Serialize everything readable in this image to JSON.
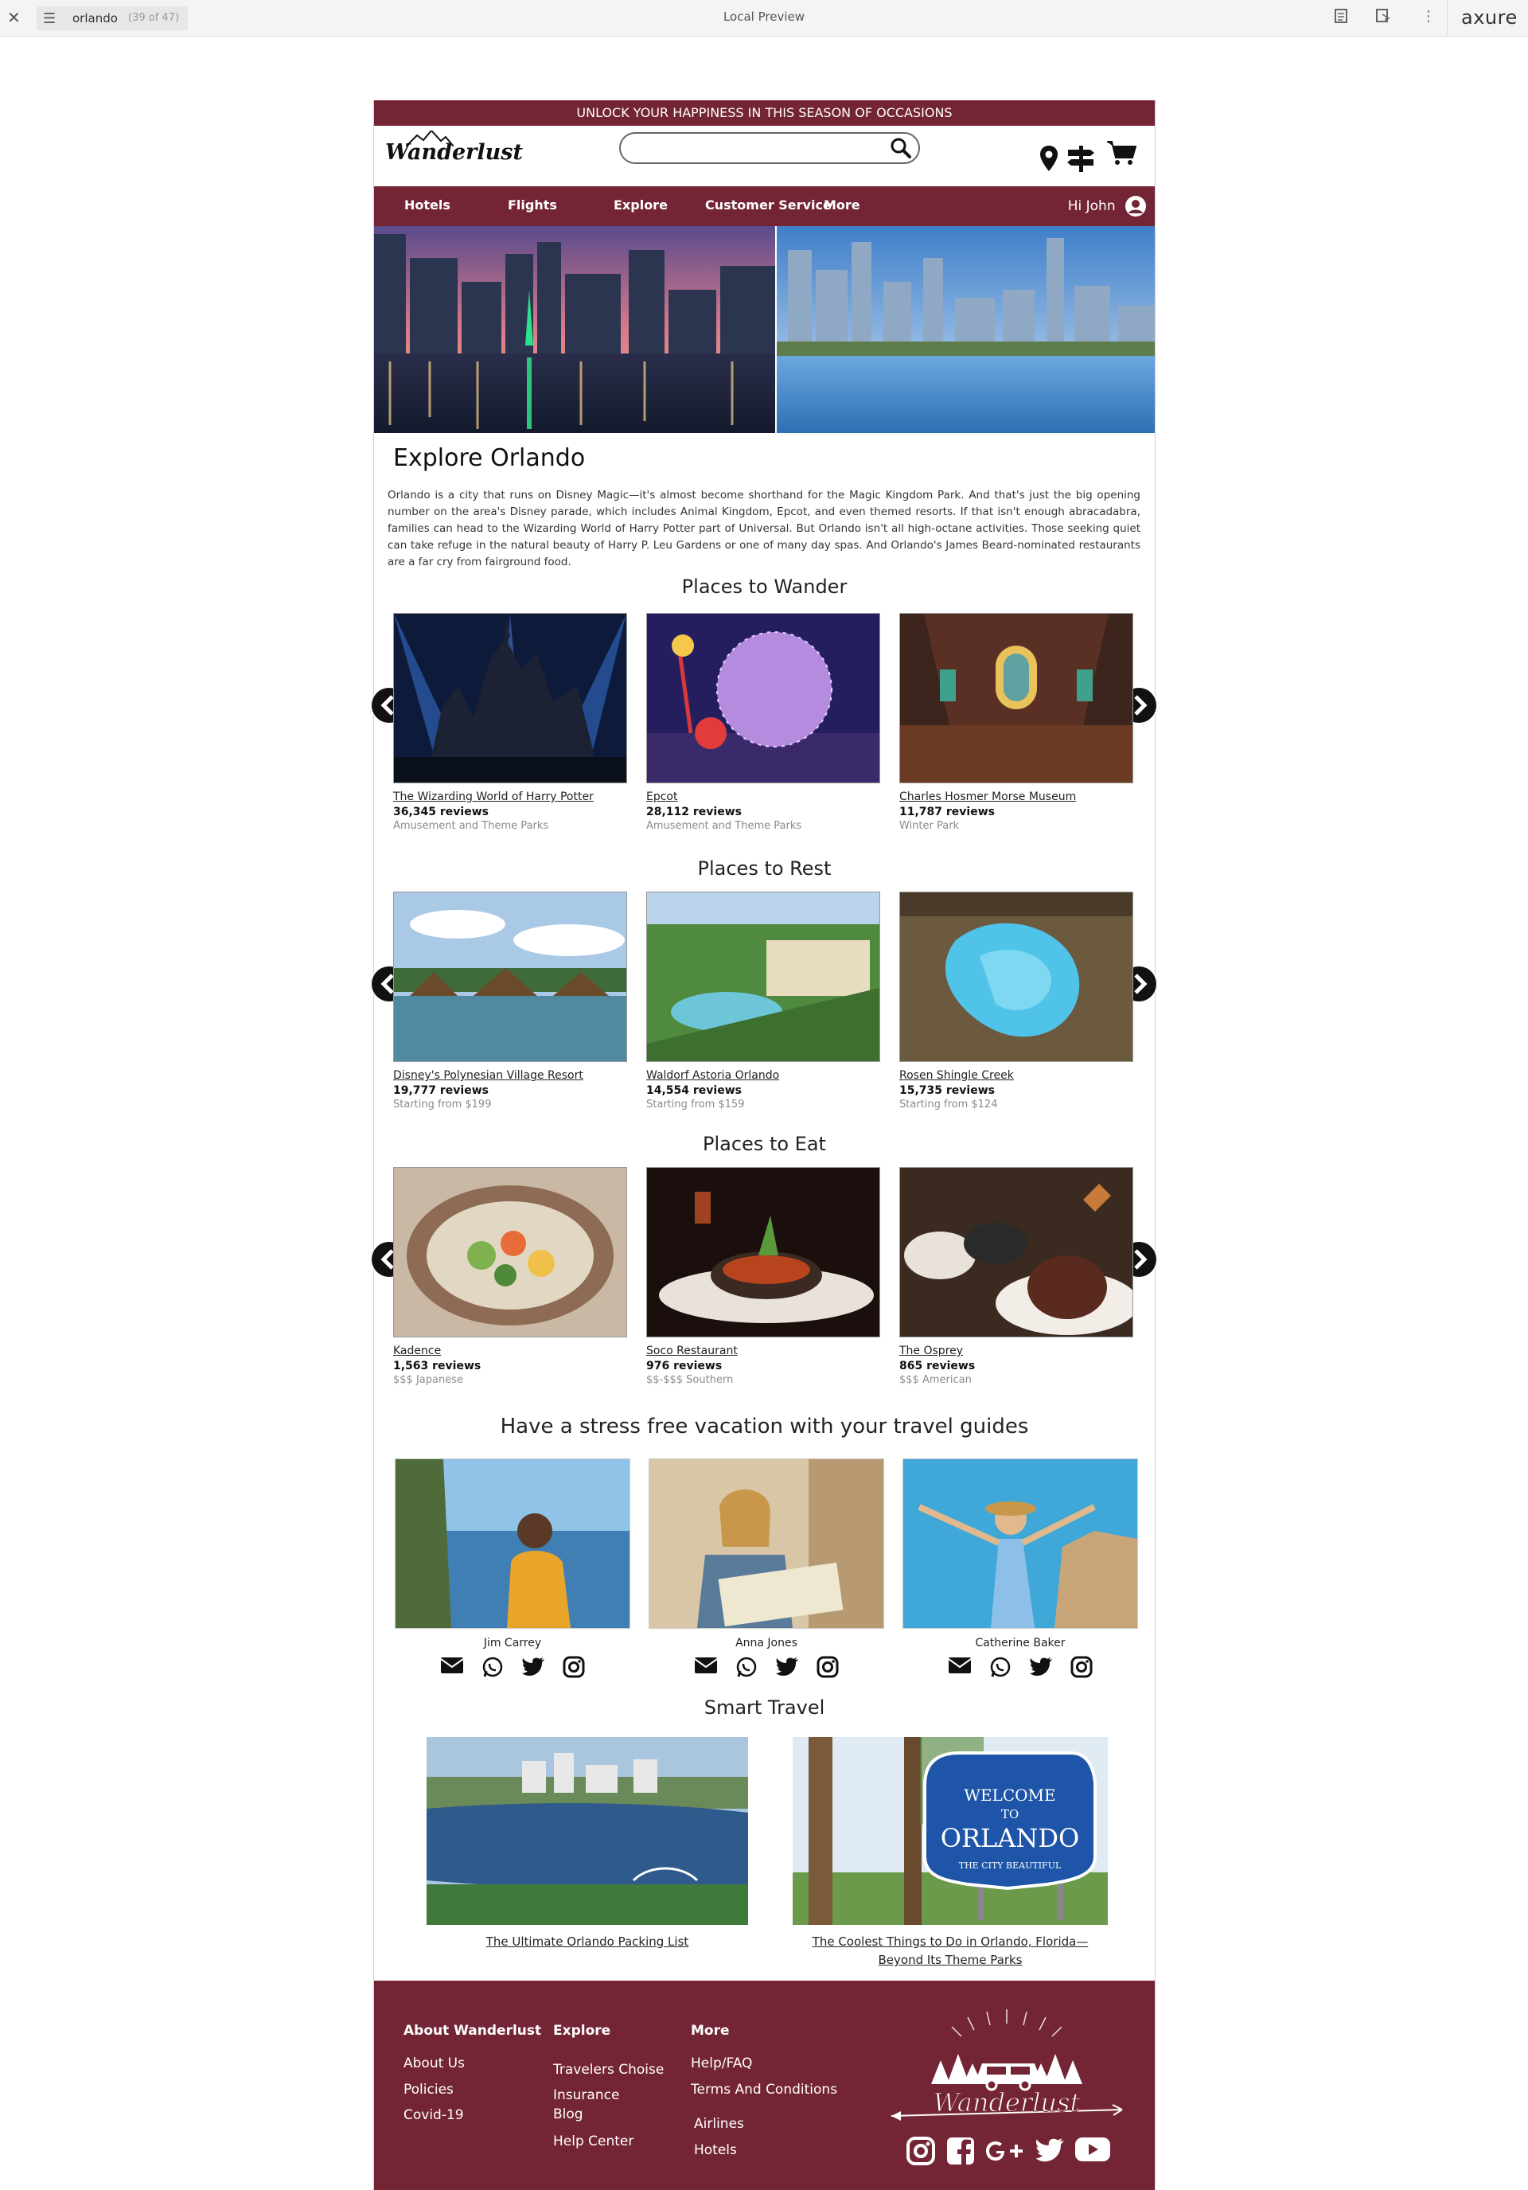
{
  "viewer": {
    "page_name": "orlando",
    "page_count": "(39 of 47)",
    "title": "Local Preview",
    "brand": "axure"
  },
  "promo": {
    "text": "UNLOCK YOUR HAPPINESS IN THIS SEASON OF OCCASIONS"
  },
  "header": {
    "logo_text": "Wanderlust",
    "search_placeholder": "",
    "icons": [
      "location-pin-icon",
      "signpost-icon",
      "cart-icon"
    ]
  },
  "nav": {
    "items": [
      "Hotels",
      "Flights",
      "Explore",
      "Customer Service",
      "More"
    ],
    "user_greeting": "Hi John"
  },
  "explore": {
    "title": "Explore Orlando",
    "text": "Orlando is a city that runs on Disney Magic—it's almost become shorthand for the Magic Kingdom Park. And that's just the big opening number on the area's Disney parade, which includes Animal Kingdom, Epcot, and even themed resorts. If that isn't enough abracadabra, families can head to the Wizarding World of Harry Potter part of Universal. But Orlando isn't all high-octane activities. Those seeking quiet can take refuge in the natural beauty of Harry P. Leu Gardens or one of many day spas. And Orlando's James Beard-nominated restaurants are a far cry from fairground food."
  },
  "wander": {
    "title": "Places to Wander",
    "items": [
      {
        "name": "The Wizarding World of Harry Potter",
        "reviews": "36,345 reviews",
        "sub": "Amusement and Theme Parks"
      },
      {
        "name": "Epcot",
        "reviews": "28,112 reviews",
        "sub": "Amusement and Theme Parks"
      },
      {
        "name": "Charles Hosmer Morse Museum",
        "reviews": "11,787 reviews",
        "sub": "Winter Park"
      }
    ]
  },
  "rest": {
    "title": "Places to Rest",
    "items": [
      {
        "name": "Disney's Polynesian Village Resort",
        "reviews": "19,777 reviews",
        "sub": "Starting from $199"
      },
      {
        "name": "Waldorf Astoria Orlando",
        "reviews": "14,554 reviews",
        "sub": "Starting from $159"
      },
      {
        "name": "Rosen Shingle Creek",
        "reviews": "15,735 reviews",
        "sub": "Starting from $124"
      }
    ]
  },
  "eat": {
    "title": "Places to Eat",
    "items": [
      {
        "name": "Kadence",
        "reviews": "1,563 reviews",
        "sub": "$$$ Japanese"
      },
      {
        "name": "Soco Restaurant",
        "reviews": "976 reviews",
        "sub": "$$-$$$ Southern"
      },
      {
        "name": "The Osprey",
        "reviews": "865 reviews",
        "sub": "$$$ American"
      }
    ]
  },
  "guides": {
    "title": "Have a stress free vacation with your travel guides",
    "items": [
      {
        "name": "Jim Carrey"
      },
      {
        "name": "Anna Jones"
      },
      {
        "name": "Catherine Baker"
      }
    ],
    "social_icons": [
      "envelope-icon",
      "whatsapp-icon",
      "twitter-icon",
      "instagram-icon"
    ]
  },
  "smart": {
    "title": "Smart Travel",
    "items": [
      {
        "caption": "The Ultimate Orlando Packing List"
      },
      {
        "caption_line1": "The Coolest Things to Do in Orlando, Florida—",
        "caption_line2": "Beyond Its Theme Parks"
      }
    ],
    "sign_lines": [
      "WELCOME",
      "TO",
      "ORLANDO",
      "THE CITY BEAUTIFUL"
    ]
  },
  "footer": {
    "col1": {
      "heading": "About Wanderlust",
      "links": [
        "About Us",
        "Policies",
        "Covid-19"
      ]
    },
    "col2": {
      "heading": "Explore",
      "links": [
        "Travelers Choise",
        "Insurance",
        "Blog",
        "Help Center"
      ]
    },
    "col3": {
      "heading": "More",
      "links": [
        "Help/FAQ",
        "Terms And Conditions",
        "Airlines",
        "Hotels"
      ]
    },
    "logo_text": "Wanderlust",
    "social_icons": [
      "instagram-icon",
      "facebook-icon",
      "google-plus-icon",
      "twitter-icon",
      "youtube-icon"
    ]
  },
  "colors": {
    "brand": "#742535",
    "text": "#222222",
    "muted": "#8a8a8a"
  }
}
